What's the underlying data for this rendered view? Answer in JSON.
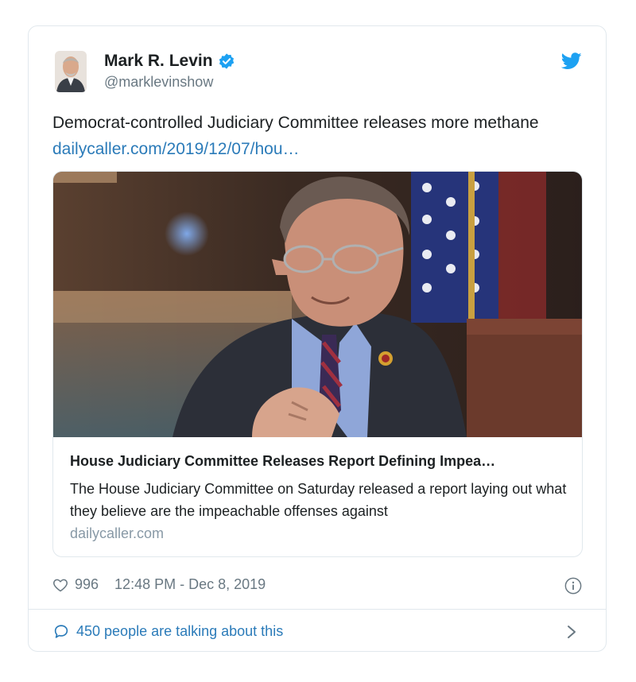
{
  "tweet": {
    "author_name": "Mark R. Levin",
    "handle": "@marklevinshow",
    "text": "Democrat-controlled Judiciary Committee releases more methane",
    "link": "dailycaller.com/2019/12/07/hou…",
    "likes": "996",
    "timestamp": "12:48 PM - Dec 8, 2019"
  },
  "link_card": {
    "title": "House Judiciary Committee Releases Report Defining Impea…",
    "description": "The House Judiciary Committee on Saturday released a report laying out what they believe are the impeachable offenses against",
    "domain": "dailycaller.com"
  },
  "footer": {
    "talking_label": "450 people are talking about this"
  },
  "icons": {
    "verified": "verified-badge-icon",
    "brand": "twitter-bird-icon",
    "like": "heart-icon",
    "info": "info-icon",
    "reply": "speech-bubble-icon",
    "more": "chevron-right-icon"
  },
  "colors": {
    "link": "#2b7bb9",
    "brand": "#1da1f2",
    "muted": "#697882",
    "border": "#e1e8ed"
  }
}
